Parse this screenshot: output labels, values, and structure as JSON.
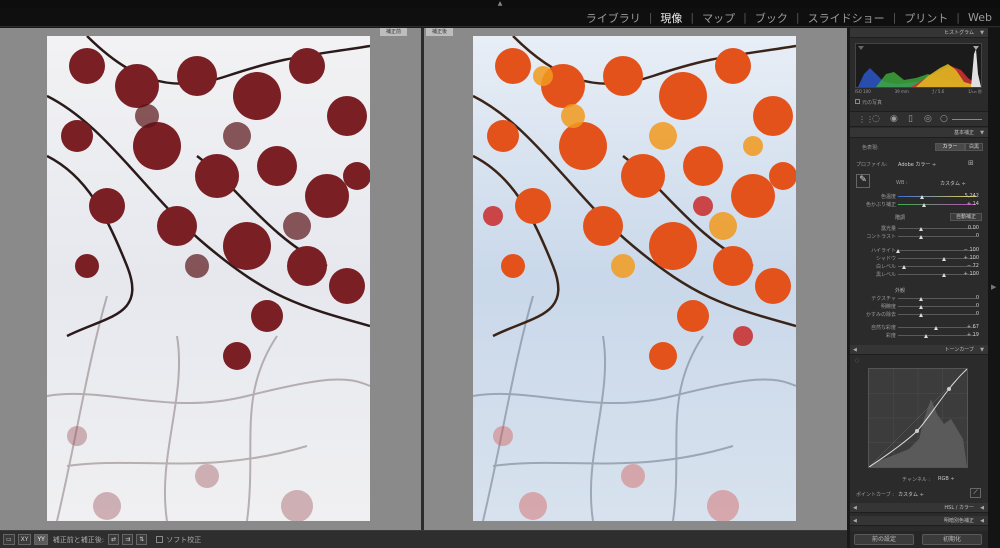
{
  "app": {
    "top_arrow": "▲"
  },
  "modules": [
    {
      "label": "ライブラリ",
      "active": false
    },
    {
      "label": "現像",
      "active": true
    },
    {
      "label": "マップ",
      "active": false
    },
    {
      "label": "ブック",
      "active": false
    },
    {
      "label": "スライドショー",
      "active": false
    },
    {
      "label": "プリント",
      "active": false
    },
    {
      "label": "Web",
      "active": false
    }
  ],
  "module_separator": "|",
  "compare": {
    "before_label": "補正前",
    "after_label": "補正後"
  },
  "toolbar": {
    "view_loupe": "▭",
    "view_compare": "XY",
    "view_yy": "YY",
    "before_after_label": "補正前と補正後:",
    "swap_icon": "⇄",
    "copy_icon": "⇉",
    "soft_proof_label": "ソフト校正"
  },
  "histogram": {
    "header": "ヒストグラム",
    "iso": "ISO 100",
    "focal": "39 mm",
    "aperture": "ƒ / 5.6",
    "shutter": "1/₁₂₅ 秒",
    "original_photo": "元の写真"
  },
  "basic": {
    "header": "基本補正",
    "treatment_label": "色表現:",
    "color_btn": "カラー",
    "bw_btn": "白黒",
    "profile_label": "プロファイル:",
    "profile_value": "Adobe カラー ÷",
    "wb_label": "WB :",
    "wb_value": "カスタム ÷",
    "sliders": [
      {
        "name": "temp",
        "label": "色温度",
        "value": "5,242",
        "pos": 0.52,
        "grad": "linear-gradient(90deg,#3a6fd0,#e8d24a)"
      },
      {
        "name": "tint",
        "label": "色かぶり補正",
        "value": "+ 14",
        "pos": 0.57,
        "grad": "linear-gradient(90deg,#3fb04a,#c04ac0)"
      }
    ],
    "tone_label": "階調",
    "auto_btn": "自動補正",
    "tone_sliders": [
      {
        "name": "exposure",
        "label": "露光量",
        "value": "0.00",
        "pos": 0.5
      },
      {
        "name": "contrast",
        "label": "コントラスト",
        "value": "0",
        "pos": 0.5
      },
      {
        "name": "highlights",
        "label": "ハイライト",
        "value": "− 100",
        "pos": 0.0
      },
      {
        "name": "shadows",
        "label": "シャドウ",
        "value": "+ 100",
        "pos": 1.0
      },
      {
        "name": "whites",
        "label": "白レベル",
        "value": "− 72",
        "pos": 0.14
      },
      {
        "name": "blacks",
        "label": "黒レベル",
        "value": "+ 100",
        "pos": 1.0
      }
    ],
    "presence_label": "外観",
    "presence_sliders": [
      {
        "name": "texture",
        "label": "テクスチャ",
        "value": "0",
        "pos": 0.5
      },
      {
        "name": "clarity",
        "label": "明瞭度",
        "value": "0",
        "pos": 0.5
      },
      {
        "name": "dehaze",
        "label": "かすみの除去",
        "value": "0",
        "pos": 0.5
      },
      {
        "name": "vibrance",
        "label": "自然な彩度",
        "value": "+ 67",
        "pos": 0.83
      },
      {
        "name": "saturation",
        "label": "彩度",
        "value": "+ 19",
        "pos": 0.6
      }
    ]
  },
  "tone_curve": {
    "header": "トーンカーブ",
    "channel_label": "チャンネル :",
    "channel_value": "RGB ÷",
    "point_curve_label": "ポイントカーブ :",
    "point_curve_value": "カスタム ÷"
  },
  "hsl": {
    "header": "HSL / カラー"
  },
  "detail": {
    "header": "明暗別色補正"
  },
  "bottom": {
    "prev_btn": "前の設定",
    "reset_btn": "初期化"
  }
}
